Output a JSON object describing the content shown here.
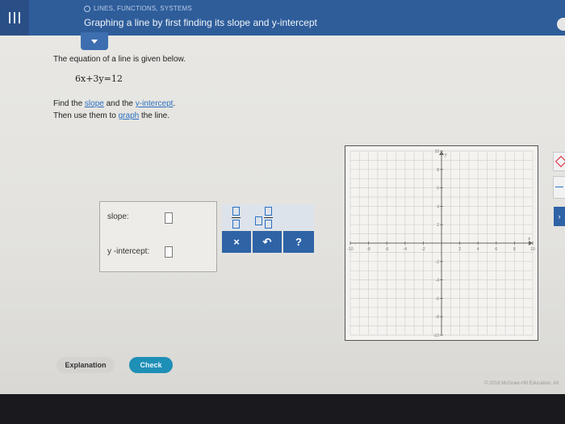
{
  "header": {
    "breadcrumb": "LINES, FUNCTIONS, SYSTEMS",
    "title": "Graphing a line by first finding its slope and y-intercept"
  },
  "problem": {
    "intro": "The equation of a line is given below.",
    "equation": "6x+3y=12",
    "find_prefix": "Find the ",
    "slope_link": "slope",
    "find_and": " and the ",
    "intercept_link": "y-intercept",
    "find_end": ".",
    "then_prefix": "Then use them to ",
    "graph_link": "graph",
    "then_end": " the line."
  },
  "answer": {
    "slope_label": "slope:",
    "intercept_label": "y -intercept:"
  },
  "keypad": {
    "clear_label": "×",
    "undo_label": "↶",
    "help_label": "?"
  },
  "graph": {
    "x_label": "x",
    "y_label": "y",
    "x_ticks": [
      "-10",
      "-8",
      "-6",
      "-4",
      "-2",
      "2",
      "4",
      "6",
      "8",
      "10"
    ],
    "y_ticks": [
      "10",
      "8",
      "6",
      "4",
      "2",
      "-2",
      "-4",
      "-6",
      "-8",
      "-10"
    ],
    "xlim": [
      -10,
      10
    ],
    "ylim": [
      -10,
      10
    ]
  },
  "footer": {
    "explanation_label": "Explanation",
    "check_label": "Check",
    "copyright": "© 2018 McGraw-Hill Education. All"
  },
  "colors": {
    "header_bg": "#2e5d9a",
    "link": "#2b6fc3",
    "check_bg": "#1e8fb6",
    "keypad_btn": "#2e63a6"
  }
}
